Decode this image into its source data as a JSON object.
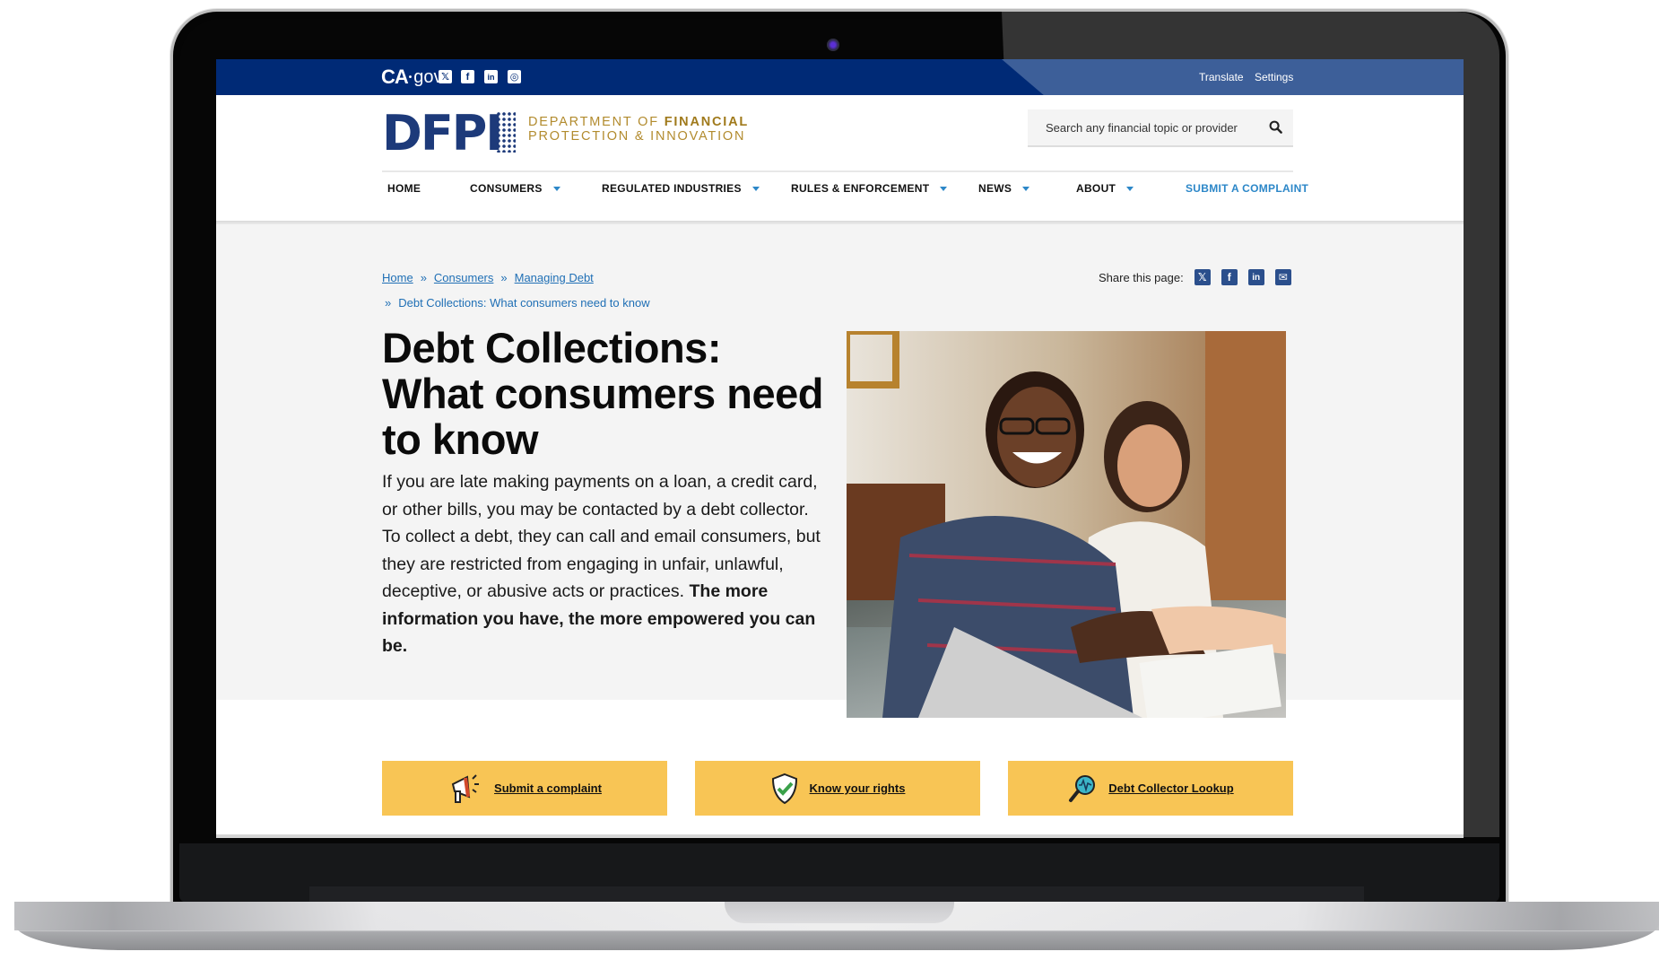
{
  "topbar": {
    "brand": "CA",
    "brand_suffix": "gov",
    "social_icons": [
      "x-icon",
      "facebook-icon",
      "linkedin-icon",
      "instagram-icon"
    ],
    "links": [
      "Translate",
      "Settings"
    ]
  },
  "header": {
    "logo_text": "DFPI",
    "dept_line1_light": "DEPARTMENT OF ",
    "dept_line1_bold": "FINANCIAL",
    "dept_line2": "PROTECTION & INNOVATION",
    "search_placeholder": "Search any financial topic or provider"
  },
  "nav": {
    "items": [
      {
        "label": "HOME",
        "dropdown": false
      },
      {
        "label": "CONSUMERS",
        "dropdown": true
      },
      {
        "label": "REGULATED INDUSTRIES",
        "dropdown": true
      },
      {
        "label": "RULES & ENFORCEMENT",
        "dropdown": true
      },
      {
        "label": "NEWS",
        "dropdown": true
      },
      {
        "label": "ABOUT",
        "dropdown": true
      },
      {
        "label": "SUBMIT A COMPLAINT",
        "dropdown": false
      }
    ]
  },
  "breadcrumb": {
    "items": [
      "Home",
      "Consumers",
      "Managing Debt"
    ],
    "current": "Debt Collections: What consumers need to know",
    "separator": "»"
  },
  "share": {
    "label": "Share this page:",
    "icons": [
      "x-icon",
      "facebook-icon",
      "linkedin-icon",
      "email-icon"
    ]
  },
  "hero": {
    "title": "Debt Collections: What consumers need to know",
    "body_regular": "If you are late making payments on a loan, a credit card, or other bills, you may be contacted by a debt collector. To collect a debt, they can call and email consumers, but they are restricted from engaging in unfair, unlawful, deceptive, or abusive acts or practices. ",
    "body_bold": "The more information you have, the more empowered you can be.",
    "image_alt": "Smiling couple shaking hands with an advisor at a table"
  },
  "cta": [
    {
      "label": "Submit a complaint",
      "icon": "megaphone-icon"
    },
    {
      "label": "Know your rights",
      "icon": "shield-check-icon"
    },
    {
      "label": "Debt Collector Lookup",
      "icon": "magnifier-icon"
    }
  ],
  "colors": {
    "topbar": "#002a76",
    "brand_blue": "#1d3a7a",
    "gold": "#b28b2e",
    "link": "#1f6fb5",
    "cta": "#f8c555"
  }
}
